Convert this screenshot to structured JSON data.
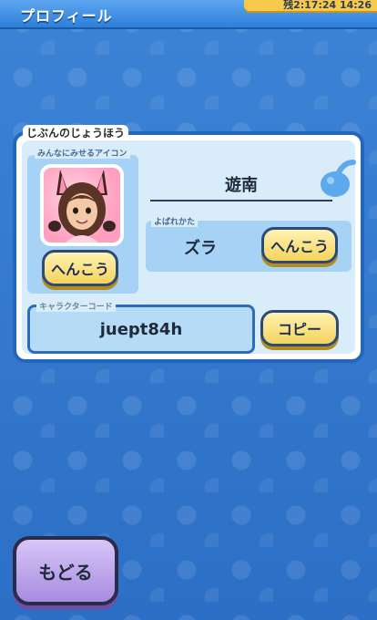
{
  "header": {
    "title": "プロフィール",
    "clock_text": "残2:17:24 14:26"
  },
  "profile": {
    "section_title": "じぶんのじょうほう",
    "icon_caption": "みんなにみせるアイコン",
    "icon_change_label": "へんこう",
    "name": "遊南",
    "reading_caption": "よばれかた",
    "reading_value": "ズラ",
    "reading_change_label": "へんこう",
    "code_caption": "キャラクターコード",
    "code_value": "juept84h",
    "copy_label": "コピー"
  },
  "footer": {
    "back_label": "もどる"
  },
  "colors": {
    "background": "#2f74c9",
    "panel_border": "#2366be",
    "button_yellow": "#f5d35c",
    "button_purple": "#a88be0"
  },
  "icons": [
    "bomb-icon",
    "avatar-image"
  ]
}
